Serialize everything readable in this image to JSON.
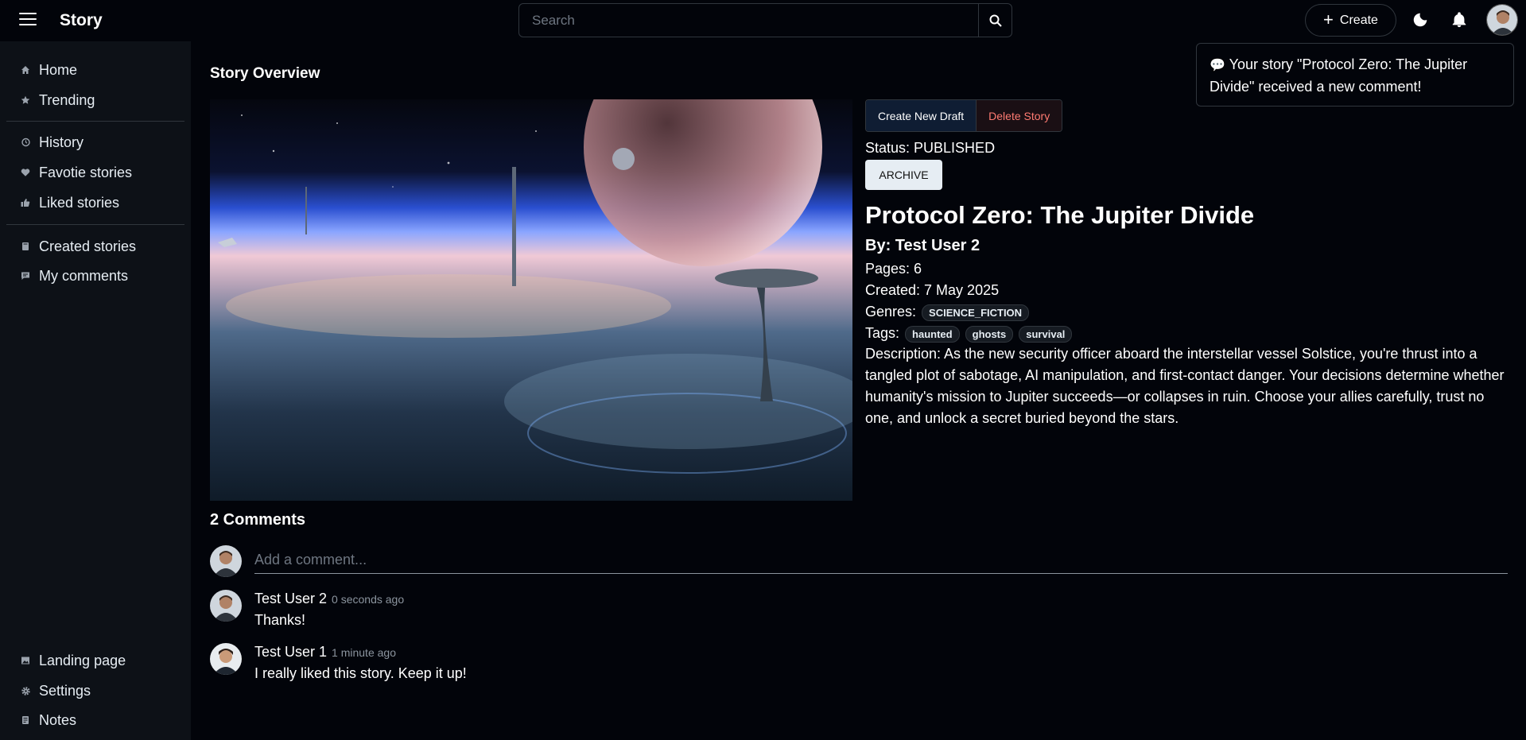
{
  "app": {
    "title": "Story"
  },
  "search": {
    "placeholder": "Search"
  },
  "header": {
    "create_label": "Create"
  },
  "sidebar": {
    "items": [
      {
        "label": "Home",
        "icon": "home-icon"
      },
      {
        "label": "Trending",
        "icon": "star-icon"
      },
      {
        "label": "History",
        "icon": "history-icon"
      },
      {
        "label": "Favotie stories",
        "icon": "heart-icon"
      },
      {
        "label": "Liked stories",
        "icon": "thumbs-up-icon"
      },
      {
        "label": "Created stories",
        "icon": "book-icon"
      },
      {
        "label": "My comments",
        "icon": "comment-icon"
      }
    ],
    "bottom_items": [
      {
        "label": "Landing page",
        "icon": "image-icon"
      },
      {
        "label": "Settings",
        "icon": "gear-icon"
      },
      {
        "label": "Notes",
        "icon": "notes-icon"
      }
    ]
  },
  "overview": {
    "section_title": "Story Overview",
    "create_draft_label": "Create New Draft",
    "delete_label": "Delete Story",
    "status_label": "Status: PUBLISHED",
    "archive_label": "ARCHIVE",
    "title": "Protocol Zero: The Jupiter Divide",
    "author": "By: Test User 2",
    "pages": "Pages: 6",
    "created": "Created: 7 May 2025",
    "genres_label": "Genres:",
    "genres": [
      "SCIENCE_FICTION"
    ],
    "tags_label": "Tags:",
    "tags": [
      "haunted",
      "ghosts",
      "survival"
    ],
    "description": "Description: As the new security officer aboard the interstellar vessel Solstice, you're thrust into a tangled plot of sabotage, AI manipulation, and first-contact danger. Your decisions determine whether humanity's mission to Jupiter succeeds—or collapses in ruin. Choose your allies carefully, trust no one, and unlock a secret buried beyond the stars."
  },
  "notification": {
    "text": "Your story \"Protocol Zero: The Jupiter Divide\" received a new comment!"
  },
  "comments": {
    "title": "2 Comments",
    "placeholder": "Add a comment...",
    "list": [
      {
        "author": "Test User 2",
        "time": "0 seconds ago",
        "text": "Thanks!"
      },
      {
        "author": "Test User 1",
        "time": "1 minute ago",
        "text": "I really liked this story. Keep it up!"
      }
    ]
  },
  "colors": {
    "background": "#02040a",
    "sidebar": "#0d1117",
    "delete_text": "#ff7b72",
    "accent_blue": "#0f1d33"
  }
}
